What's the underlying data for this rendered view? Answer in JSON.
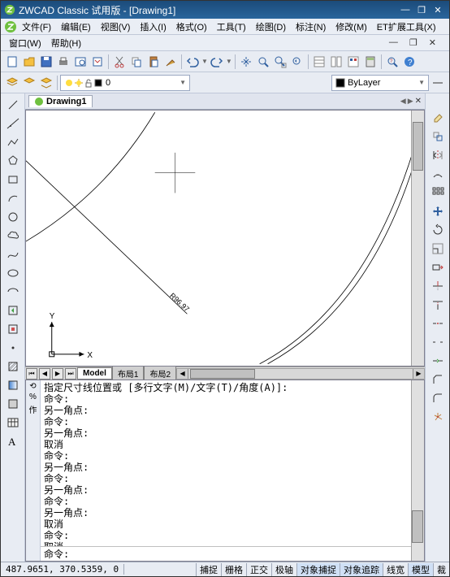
{
  "titlebar": {
    "title": "ZWCAD Classic 试用版 - [Drawing1]"
  },
  "menu1": {
    "file": "文件(F)",
    "edit": "编辑(E)",
    "view": "视图(V)",
    "insert": "插入(I)",
    "format": "格式(O)",
    "tools": "工具(T)",
    "draw": "绘图(D)",
    "dimension": "标注(N)",
    "modify": "修改(M)",
    "et": "ET扩展工具(X)"
  },
  "menu2": {
    "window": "窗口(W)",
    "help": "帮助(H)"
  },
  "layer": {
    "name": "0",
    "bylayer": "ByLayer"
  },
  "doc": {
    "name": "Drawing1"
  },
  "layout": {
    "model": "Model",
    "l1": "布局1",
    "l2": "布局2"
  },
  "ucs": {
    "x": "X",
    "y": "Y"
  },
  "dimtext": "R96.97",
  "cmd": {
    "prompt": "指定尺寸线位置或 [多行文字(M)/文字(T)/角度(A)]:",
    "cmdlabel": "命令:",
    "pt": "另一角点:",
    "cancel": "取消",
    "inputlabel": "命令:"
  },
  "status": {
    "coord": "487.9651, 370.5359, 0",
    "snap": "捕捉",
    "grid": "栅格",
    "ortho": "正交",
    "polar": "极轴",
    "osnap": "对象捕捉",
    "otrack": "对象追踪",
    "lwt": "线宽",
    "model": "模型",
    "clip": "裁"
  }
}
